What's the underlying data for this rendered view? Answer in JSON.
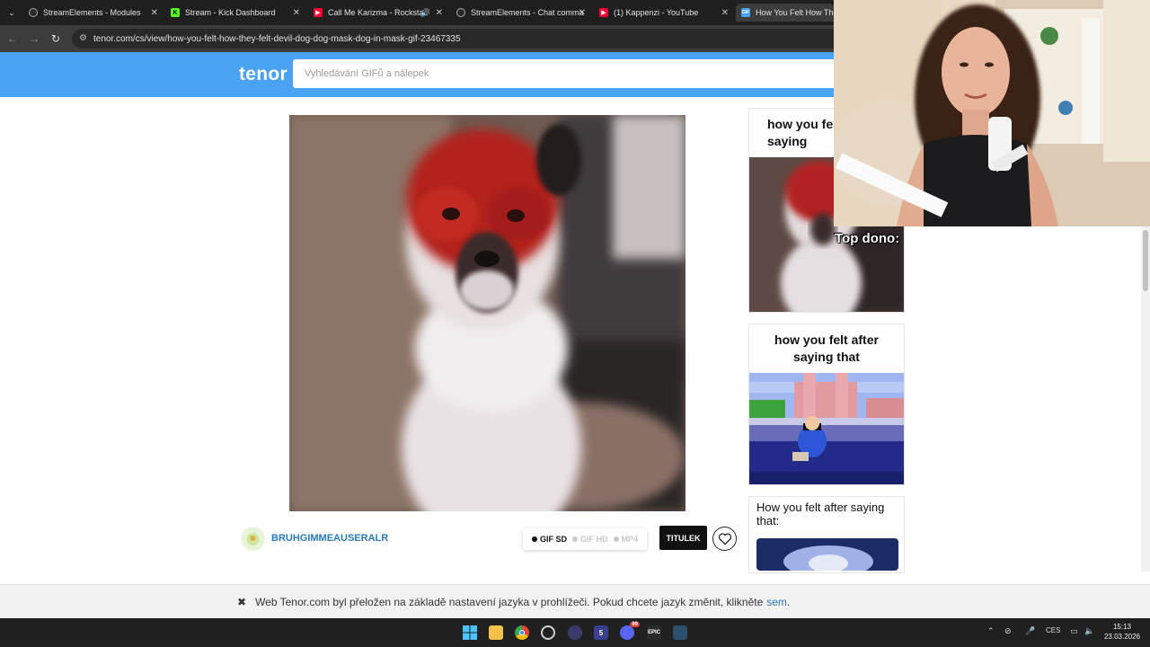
{
  "browser": {
    "tabs": [
      {
        "label": "StreamElements - Modules",
        "favicon": "streamelements-icon",
        "active": false
      },
      {
        "label": "Stream - Kick Dashboard",
        "favicon": "kick-icon",
        "active": false
      },
      {
        "label": "Call Me Karizma - Rockstar",
        "favicon": "youtube-icon",
        "active": false
      },
      {
        "label": "StreamElements - Chat comma",
        "favicon": "streamelements-icon",
        "active": false
      },
      {
        "label": "(1) Kappenzi - YouTube",
        "favicon": "youtube-icon",
        "active": false
      },
      {
        "label": "How You Felt How They F",
        "favicon": "gif-icon",
        "active": true
      }
    ],
    "url": "tenor.com/cs/view/how-you-felt-how-they-felt-devil-dog-dog-mask-dog-in-mask-gif-23467335"
  },
  "tenor": {
    "logo": "tenor",
    "search_placeholder": "Vyhledávání GIFů a nálepek",
    "accent": "#4aa2f3"
  },
  "gif": {
    "username": "BRUHGIMMEAUSERALR",
    "formats": [
      "GIF SD",
      "GIF HD",
      "MP4"
    ],
    "selected_format": "GIF SD",
    "caption_button": "TITULEK",
    "favorite_icon": "heart-icon"
  },
  "related": [
    {
      "caption": "how you felt after saying"
    },
    {
      "caption": "how you felt after saying that"
    },
    {
      "caption": "How you felt after saying that:"
    }
  ],
  "overlay": {
    "top_dono": "Top dono:"
  },
  "notice": {
    "text": "Web Tenor.com byl přeložen na základě nastavení jazyka v prohlížeči. Pokud chcete jazyk změnit, klikněte",
    "link": "sem",
    "end": "."
  },
  "taskbar": {
    "language": "CES",
    "time": "15:13",
    "date": "23.03.2026",
    "discord_badge": "99"
  }
}
